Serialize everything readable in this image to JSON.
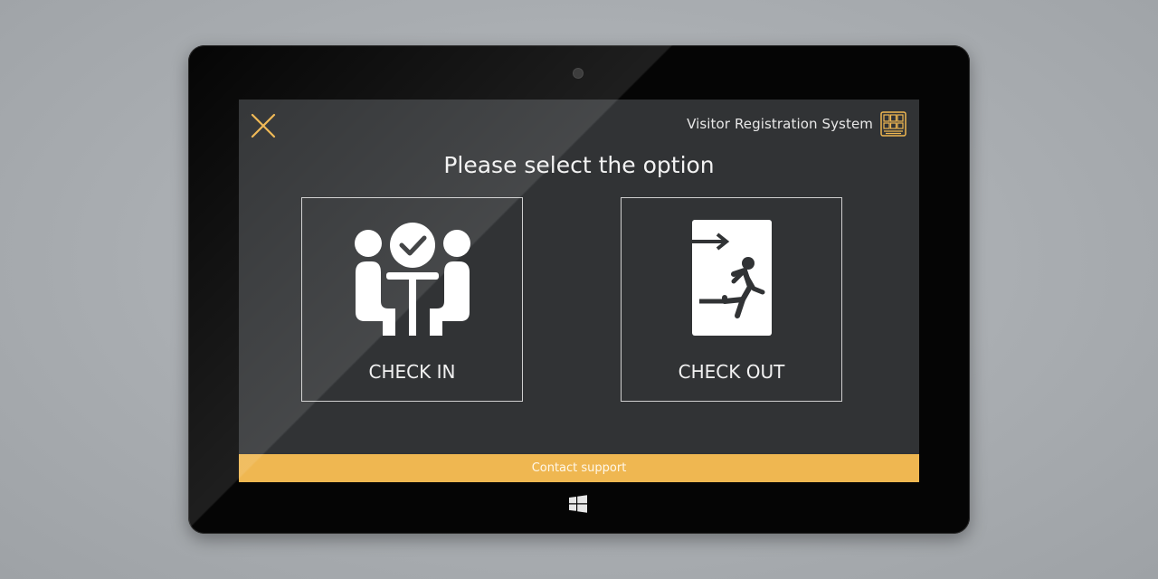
{
  "app": {
    "title": "Visitor Registration System",
    "logo_icon": "building-icon"
  },
  "header": {
    "close_icon": "close-icon"
  },
  "main": {
    "prompt": "Please select the option",
    "options": [
      {
        "label": "CHECK IN",
        "icon": "meeting-table-check-icon"
      },
      {
        "label": "CHECK OUT",
        "icon": "exit-running-man-icon"
      }
    ]
  },
  "footer": {
    "support_label": "Contact support"
  },
  "device": {
    "start_button_icon": "windows-logo-icon"
  },
  "colors": {
    "accent": "#efb751",
    "screen_background": "#313335",
    "bezel": "#050505",
    "text": "#f2f2f2"
  }
}
